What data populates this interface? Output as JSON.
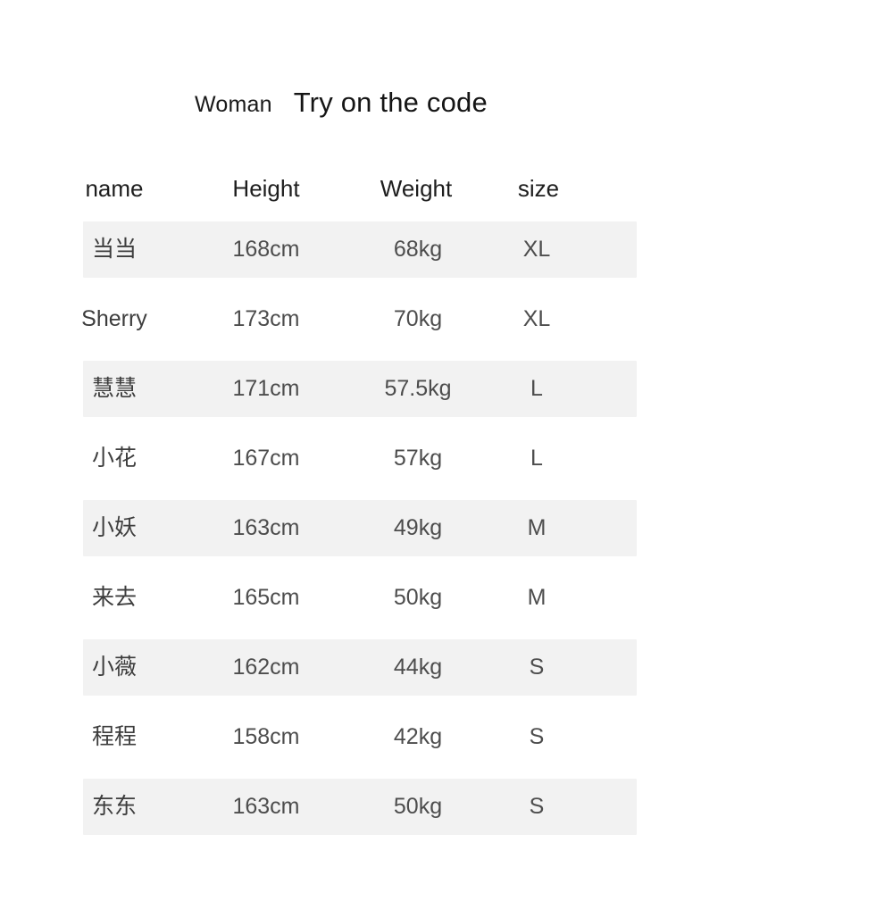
{
  "title": {
    "prefix": "Woman",
    "main": "Try on the code"
  },
  "table": {
    "headers": {
      "name": "name",
      "height": "Height",
      "weight": "Weight",
      "size": "size"
    },
    "rows": [
      {
        "name": "当当",
        "height": "168cm",
        "weight": "68kg",
        "size": "XL"
      },
      {
        "name": "Sherry",
        "height": "173cm",
        "weight": "70kg",
        "size": "XL"
      },
      {
        "name": "慧慧",
        "height": "171cm",
        "weight": "57.5kg",
        "size": "L"
      },
      {
        "name": "小花",
        "height": "167cm",
        "weight": "57kg",
        "size": "L"
      },
      {
        "name": "小妖",
        "height": "163cm",
        "weight": "49kg",
        "size": "M"
      },
      {
        "name": "来去",
        "height": "165cm",
        "weight": "50kg",
        "size": "M"
      },
      {
        "name": "小薇",
        "height": "162cm",
        "weight": "44kg",
        "size": "S"
      },
      {
        "name": "程程",
        "height": "158cm",
        "weight": "42kg",
        "size": "S"
      },
      {
        "name": "东东",
        "height": "163cm",
        "weight": "50kg",
        "size": "S"
      }
    ]
  },
  "colors": {
    "page_background": "#ffffff",
    "stripe_background": "#f2f2f2",
    "header_text": "#1e1e1e",
    "cell_text": "#4d4d4d",
    "title_text": "#151515"
  }
}
